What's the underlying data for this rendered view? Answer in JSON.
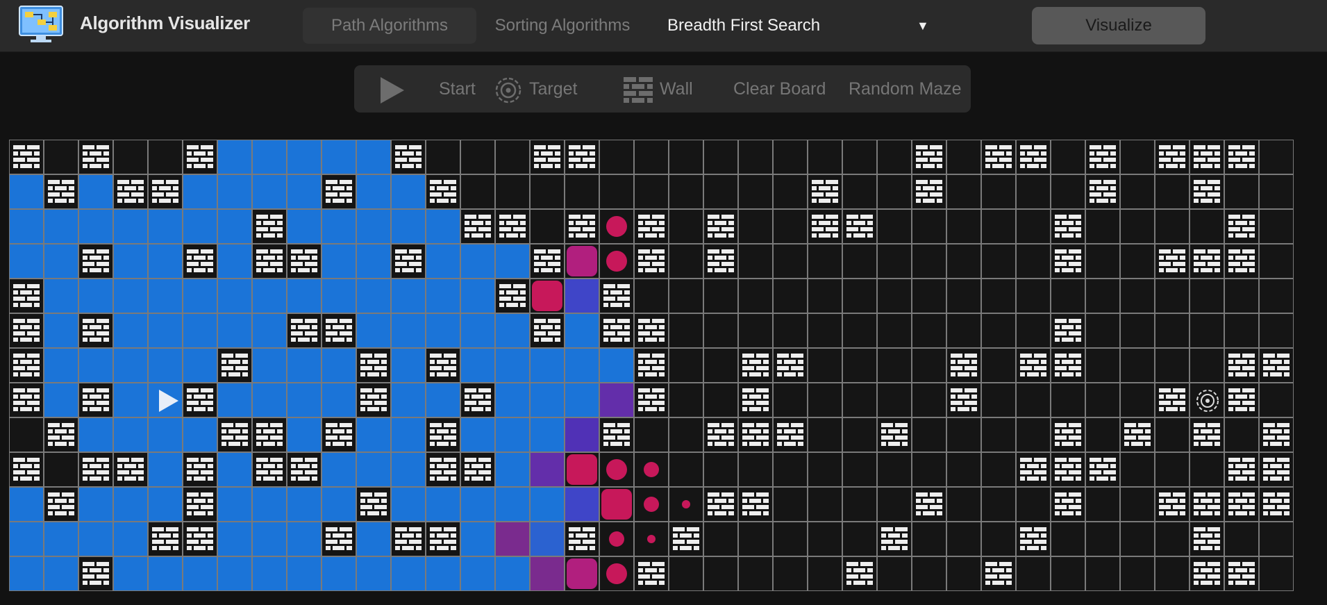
{
  "app": {
    "title": "Algorithm Visualizer",
    "logo_icon": "computer-diagram-icon"
  },
  "nav": {
    "tabs": [
      {
        "label": "Path Algorithms",
        "active": true
      },
      {
        "label": "Sorting Algorithms",
        "active": false
      }
    ],
    "algorithm_select": {
      "value": "Breadth First Search",
      "caret_icon": "triangle-down-icon"
    },
    "visualize_label": "Visualize"
  },
  "toolbar": {
    "items": [
      {
        "label": "Start",
        "icon": "play-icon"
      },
      {
        "label": "Target",
        "icon": "target-icon"
      },
      {
        "label": "Wall",
        "icon": "brick-wall-icon"
      },
      {
        "label": "Clear Board",
        "icon": ""
      },
      {
        "label": "Random Maze",
        "icon": ""
      }
    ]
  },
  "colors": {
    "visited": "#1b74d8",
    "frontier_light": "#2b62d0",
    "frontier_indigo": "#5031b6",
    "frontier_violet": "#632eaa",
    "frontier_purple": "#7a2b8e",
    "frontier_lavender": "#3f45c8",
    "frontier_magenta": "#c7185a",
    "wall": "#141414",
    "empty": "#151515"
  },
  "board": {
    "columns": 37,
    "rows": 13,
    "legend": "W = wall, V = visited, S = start, T = target, . = empty; a,b,c,d,e = visited shades; M/P = node squares; 1/2/3 = shrinking frontier dots",
    "cells": [
      "W.W..WVVVVVW...WW.........W.WW.W.WWW.",
      "VWVWWVVVVWVVW..........W..W....W..W..",
      "VVVVVVVWVVVVVWW.W1W.W..WW.....W....W.",
      "VVWVVWVWWVVWVVVWP1W.W.........W..WWW.",
      "WVVVVVVVVVVVVVWMcW...................",
      "WVWVVVVVWWVVVVVWVWW...........W......",
      "WVVVVVWVVVWVWVVVVVW..WW....W.WW....WW",
      "WVWVSWVVVVWVVWVVVbW..W.....W.....WTW.W",
      ".WVVVVWWVWVVWVVVaW..WWW..W....W.W.W.W",
      "W.WWVWVWWVVVWWVbM12..........WWW...WW.",
      "VWVVVWVVVVWVVVVVcM23WW....W...W..WWWW.W",
      "VVVVWWVVVWVWWVdeW23W.....W...W....W...",
      "VVWVVVVVVVVVVVVdP1W.....W...W.....WW.."
    ],
    "start": {
      "row": 7,
      "col": 4,
      "icon": "play-icon"
    },
    "target": {
      "row": 7,
      "col": 33,
      "icon": "target-icon"
    }
  }
}
